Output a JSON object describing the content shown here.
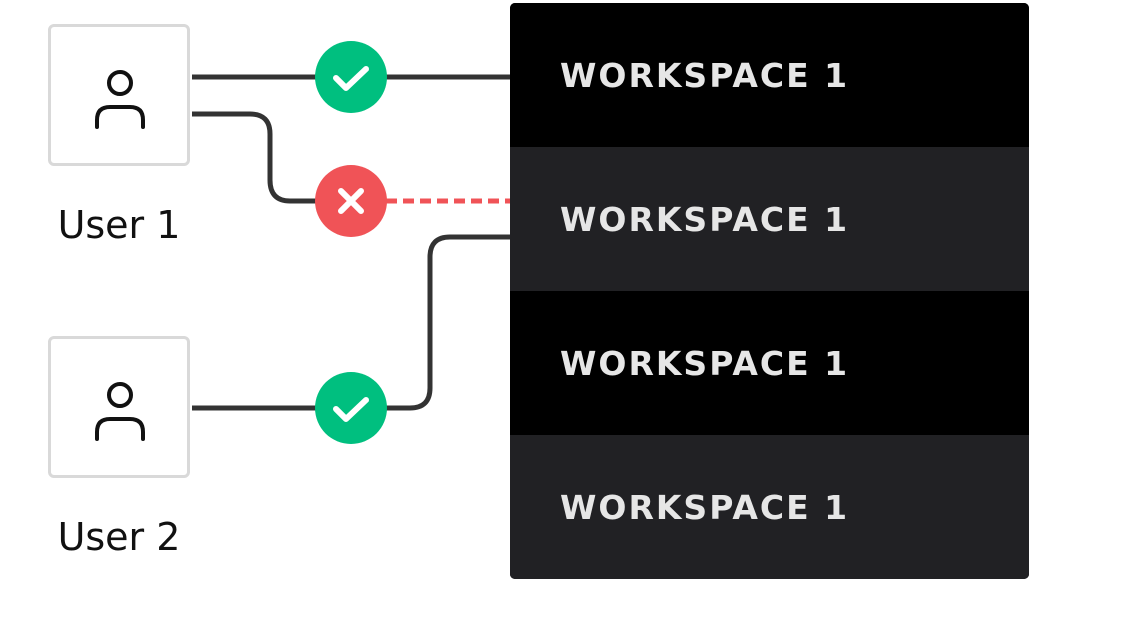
{
  "users": [
    {
      "label": "User 1",
      "icon": "user-icon"
    },
    {
      "label": "User 2",
      "icon": "user-icon"
    }
  ],
  "workspaces": [
    {
      "label": "WORKSPACE 1"
    },
    {
      "label": "WORKSPACE 1"
    },
    {
      "label": "WORKSPACE 1"
    },
    {
      "label": "WORKSPACE 1"
    }
  ],
  "connections": [
    {
      "from": "User 1",
      "to_row": 1,
      "status": "allowed",
      "icon": "check-icon"
    },
    {
      "from": "User 1",
      "to_row": 2,
      "status": "denied",
      "icon": "x-icon"
    },
    {
      "from": "User 2",
      "to_row": 2,
      "status": "allowed",
      "icon": "check-icon"
    }
  ],
  "colors": {
    "allowed": "#00bf7f",
    "denied": "#f05357",
    "line": "#333333",
    "panel_dark": "#000000",
    "panel_gray": "#212124",
    "workspace_text": "#e6e6e6"
  }
}
